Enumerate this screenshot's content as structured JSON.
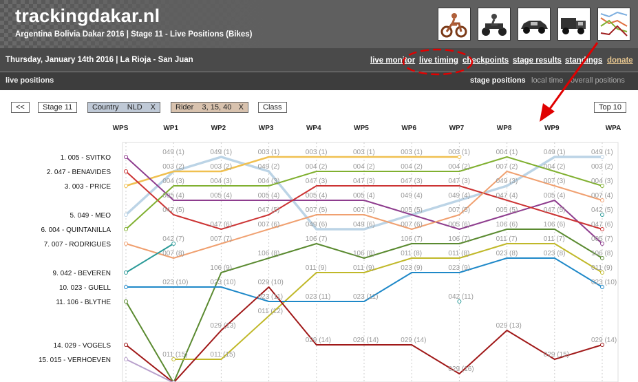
{
  "site": {
    "title": "trackingdakar.nl",
    "subtitle": "Argentina Bolivia Dakar 2016 | Stage 11 - Live Positions (Bikes)",
    "categories": [
      {
        "name": "bike-icon"
      },
      {
        "name": "quad-icon"
      },
      {
        "name": "car-icon"
      },
      {
        "name": "truck-icon"
      },
      {
        "name": "chart-icon"
      }
    ]
  },
  "subbar": {
    "date": "Thursday, January 14th 2016 | La Rioja - San Juan",
    "nav": [
      "live monitor",
      "live timing",
      "checkpoints",
      "stage results",
      "standings",
      "donate"
    ]
  },
  "viewbar": {
    "left": "live positions",
    "right": [
      "stage positions",
      "local time",
      "overall positions"
    ]
  },
  "filters": {
    "prev": "<<",
    "stage": "Stage 11",
    "country": "Country    NLD",
    "rider": "Rider    3, 15, 40",
    "class": "Class",
    "top": "Top 10",
    "remove": "X"
  },
  "colors": {
    "header_bg": "#5f5f5f",
    "subbar_bg": "#4a4a4a",
    "donate": "#e8c790",
    "country_chip": "#bfc9d6",
    "rider_chip": "#d8c2ae",
    "annotation_red": "#e00000"
  },
  "chart_data": {
    "type": "line",
    "waypoints": [
      "WPS",
      "WP1",
      "WP2",
      "WP3",
      "WP4",
      "WP5",
      "WP6",
      "WP7",
      "WP8",
      "WP9",
      "WPA"
    ],
    "rows": [
      "1. 005 - SVITKO",
      "2. 047 - BENAVIDES",
      "3. 003 - PRICE",
      "",
      "5. 049 - MEO",
      "6. 004 - QUINTANILLA",
      "7. 007 - RODRIGUES",
      "",
      "9. 042 - BEVEREN",
      "10. 023 - GUELL",
      "11. 106 - BLYTHE",
      "",
      "",
      "14. 029 - VOGELS",
      "15. 015 - VERHOEVEN"
    ],
    "series": [
      {
        "name": "049",
        "color": "#bcd4e6",
        "width": 3.5,
        "positions": [
          5,
          2,
          1,
          2,
          6,
          6,
          5,
          4,
          3,
          1,
          1
        ]
      },
      {
        "name": "003",
        "color": "#f0c050",
        "width": 2.5,
        "positions": [
          3,
          2,
          2,
          1,
          1,
          1,
          1,
          1,
          null,
          null,
          null
        ]
      },
      {
        "name": "005",
        "color": "#8e3d8e",
        "width": 2,
        "positions": [
          1,
          4,
          4,
          4,
          4,
          4,
          5,
          6,
          5,
          4,
          7
        ]
      },
      {
        "name": "047",
        "color": "#cc3333",
        "width": 2,
        "positions": [
          2,
          5,
          6,
          5,
          3,
          3,
          3,
          3,
          4,
          5,
          6
        ]
      },
      {
        "name": "004",
        "color": "#80b030",
        "width": 2,
        "positions": [
          6,
          3,
          3,
          3,
          2,
          2,
          2,
          2,
          1,
          2,
          3
        ]
      },
      {
        "name": "007",
        "color": "#f0a070",
        "width": 2,
        "positions": [
          7,
          8,
          7,
          6,
          5,
          5,
          6,
          5,
          2,
          3,
          4
        ]
      },
      {
        "name": "042",
        "color": "#2a9a98",
        "width": 2,
        "positions": [
          9,
          7,
          null,
          null,
          null,
          null,
          null,
          11,
          null,
          null,
          5
        ]
      },
      {
        "name": "106",
        "color": "#5a8a30",
        "width": 2,
        "positions": [
          11,
          19,
          9,
          8,
          7,
          8,
          7,
          7,
          6,
          6,
          8
        ]
      },
      {
        "name": "011",
        "color": "#c0b828",
        "width": 2,
        "positions": [
          null,
          15,
          15,
          12,
          9,
          9,
          8,
          8,
          7,
          7,
          9
        ]
      },
      {
        "name": "023",
        "color": "#1e88c8",
        "width": 2,
        "positions": [
          10,
          10,
          10,
          11,
          11,
          11,
          9,
          9,
          8,
          8,
          10
        ]
      },
      {
        "name": "029",
        "color": "#a01818",
        "width": 2,
        "positions": [
          14,
          19,
          13,
          10,
          14,
          14,
          14,
          16,
          13,
          15,
          14
        ]
      },
      {
        "name": "015",
        "color": "#b8a0cc",
        "width": 2,
        "positions": [
          15,
          19,
          null,
          null,
          null,
          null,
          null,
          null,
          null,
          null,
          null
        ]
      }
    ],
    "labels": [
      {
        "text": "049 (1)",
        "wp": 1,
        "pos": 1
      },
      {
        "text": "003 (2)",
        "wp": 1,
        "pos": 2
      },
      {
        "text": "004 (3)",
        "wp": 1,
        "pos": 3
      },
      {
        "text": "005 (4)",
        "wp": 1,
        "pos": 4
      },
      {
        "text": "047 (5)",
        "wp": 1,
        "pos": 5
      },
      {
        "text": "042 (7)",
        "wp": 1,
        "pos": 7
      },
      {
        "text": "007 (8)",
        "wp": 1,
        "pos": 8
      },
      {
        "text": "023 (10)",
        "wp": 1,
        "pos": 10
      },
      {
        "text": "011 (15)",
        "wp": 1,
        "pos": 15
      },
      {
        "text": "049 (1)",
        "wp": 2,
        "pos": 1
      },
      {
        "text": "003 (2)",
        "wp": 2,
        "pos": 2
      },
      {
        "text": "004 (3)",
        "wp": 2,
        "pos": 3
      },
      {
        "text": "005 (4)",
        "wp": 2,
        "pos": 4
      },
      {
        "text": "047 (6)",
        "wp": 2,
        "pos": 6
      },
      {
        "text": "007 (7)",
        "wp": 2,
        "pos": 7
      },
      {
        "text": "106 (9)",
        "wp": 2,
        "pos": 9
      },
      {
        "text": "023 (10)",
        "wp": 2,
        "pos": 10
      },
      {
        "text": "029 (13)",
        "wp": 2,
        "pos": 13
      },
      {
        "text": "011 (15)",
        "wp": 2,
        "pos": 15
      },
      {
        "text": "003 (1)",
        "wp": 3,
        "pos": 1
      },
      {
        "text": "049 (2)",
        "wp": 3,
        "pos": 2
      },
      {
        "text": "004 (3)",
        "wp": 3,
        "pos": 3
      },
      {
        "text": "005 (4)",
        "wp": 3,
        "pos": 4
      },
      {
        "text": "047 (5)",
        "wp": 3,
        "pos": 5
      },
      {
        "text": "007 (6)",
        "wp": 3,
        "pos": 6
      },
      {
        "text": "106 (8)",
        "wp": 3,
        "pos": 8
      },
      {
        "text": "029 (10)",
        "wp": 3,
        "pos": 10
      },
      {
        "text": "023 (11)",
        "wp": 3,
        "pos": 11
      },
      {
        "text": "011 (12)",
        "wp": 3,
        "pos": 12
      },
      {
        "text": "003 (1)",
        "wp": 4,
        "pos": 1
      },
      {
        "text": "004 (2)",
        "wp": 4,
        "pos": 2
      },
      {
        "text": "047 (3)",
        "wp": 4,
        "pos": 3
      },
      {
        "text": "005 (4)",
        "wp": 4,
        "pos": 4
      },
      {
        "text": "007 (5)",
        "wp": 4,
        "pos": 5
      },
      {
        "text": "049 (6)",
        "wp": 4,
        "pos": 6
      },
      {
        "text": "106 (7)",
        "wp": 4,
        "pos": 7
      },
      {
        "text": "011 (9)",
        "wp": 4,
        "pos": 9
      },
      {
        "text": "023 (11)",
        "wp": 4,
        "pos": 11
      },
      {
        "text": "029 (14)",
        "wp": 4,
        "pos": 14
      },
      {
        "text": "003 (1)",
        "wp": 5,
        "pos": 1
      },
      {
        "text": "004 (2)",
        "wp": 5,
        "pos": 2
      },
      {
        "text": "047 (3)",
        "wp": 5,
        "pos": 3
      },
      {
        "text": "005 (4)",
        "wp": 5,
        "pos": 4
      },
      {
        "text": "007 (5)",
        "wp": 5,
        "pos": 5
      },
      {
        "text": "049 (6)",
        "wp": 5,
        "pos": 6
      },
      {
        "text": "106 (8)",
        "wp": 5,
        "pos": 8
      },
      {
        "text": "011 (9)",
        "wp": 5,
        "pos": 9
      },
      {
        "text": "023 (11)",
        "wp": 5,
        "pos": 11
      },
      {
        "text": "029 (14)",
        "wp": 5,
        "pos": 14
      },
      {
        "text": "003 (1)",
        "wp": 6,
        "pos": 1
      },
      {
        "text": "004 (2)",
        "wp": 6,
        "pos": 2
      },
      {
        "text": "047 (3)",
        "wp": 6,
        "pos": 3
      },
      {
        "text": "049 (4)",
        "wp": 6,
        "pos": 4
      },
      {
        "text": "005 (5)",
        "wp": 6,
        "pos": 5
      },
      {
        "text": "007 (6)",
        "wp": 6,
        "pos": 6
      },
      {
        "text": "106 (7)",
        "wp": 6,
        "pos": 7
      },
      {
        "text": "011 (8)",
        "wp": 6,
        "pos": 8
      },
      {
        "text": "023 (9)",
        "wp": 6,
        "pos": 9
      },
      {
        "text": "029 (14)",
        "wp": 6,
        "pos": 14
      },
      {
        "text": "003 (1)",
        "wp": 7,
        "pos": 1
      },
      {
        "text": "004 (2)",
        "wp": 7,
        "pos": 2
      },
      {
        "text": "047 (3)",
        "wp": 7,
        "pos": 3
      },
      {
        "text": "049 (4)",
        "wp": 7,
        "pos": 4
      },
      {
        "text": "007 (5)",
        "wp": 7,
        "pos": 5
      },
      {
        "text": "005 (6)",
        "wp": 7,
        "pos": 6
      },
      {
        "text": "106 (7)",
        "wp": 7,
        "pos": 7
      },
      {
        "text": "011 (8)",
        "wp": 7,
        "pos": 8
      },
      {
        "text": "023 (9)",
        "wp": 7,
        "pos": 9
      },
      {
        "text": "042 (11)",
        "wp": 7,
        "pos": 11
      },
      {
        "text": "029 (16)",
        "wp": 7,
        "pos": 16
      },
      {
        "text": "004 (1)",
        "wp": 8,
        "pos": 1
      },
      {
        "text": "007 (2)",
        "wp": 8,
        "pos": 2
      },
      {
        "text": "049 (3)",
        "wp": 8,
        "pos": 3
      },
      {
        "text": "047 (4)",
        "wp": 8,
        "pos": 4
      },
      {
        "text": "005 (5)",
        "wp": 8,
        "pos": 5
      },
      {
        "text": "106 (6)",
        "wp": 8,
        "pos": 6
      },
      {
        "text": "011 (7)",
        "wp": 8,
        "pos": 7
      },
      {
        "text": "023 (8)",
        "wp": 8,
        "pos": 8
      },
      {
        "text": "029 (13)",
        "wp": 8,
        "pos": 13
      },
      {
        "text": "049 (1)",
        "wp": 9,
        "pos": 1
      },
      {
        "text": "004 (2)",
        "wp": 9,
        "pos": 2
      },
      {
        "text": "007 (3)",
        "wp": 9,
        "pos": 3
      },
      {
        "text": "005 (4)",
        "wp": 9,
        "pos": 4
      },
      {
        "text": "047 (5)",
        "wp": 9,
        "pos": 5
      },
      {
        "text": "106 (6)",
        "wp": 9,
        "pos": 6
      },
      {
        "text": "011 (7)",
        "wp": 9,
        "pos": 7
      },
      {
        "text": "023 (8)",
        "wp": 9,
        "pos": 8
      },
      {
        "text": "029 (15)",
        "wp": 9,
        "pos": 15
      },
      {
        "text": "049 (1)",
        "wp": 10,
        "pos": 1
      },
      {
        "text": "003 (2)",
        "wp": 10,
        "pos": 2
      },
      {
        "text": "004 (3)",
        "wp": 10,
        "pos": 3
      },
      {
        "text": "007 (4)",
        "wp": 10,
        "pos": 4
      },
      {
        "text": "042 (5)",
        "wp": 10,
        "pos": 5
      },
      {
        "text": "047 (6)",
        "wp": 10,
        "pos": 6
      },
      {
        "text": "005 (7)",
        "wp": 10,
        "pos": 7
      },
      {
        "text": "106 (8)",
        "wp": 10,
        "pos": 8
      },
      {
        "text": "011 (9)",
        "wp": 10,
        "pos": 9
      },
      {
        "text": "023 (10)",
        "wp": 10,
        "pos": 10
      },
      {
        "text": "029 (14)",
        "wp": 10,
        "pos": 14
      }
    ]
  }
}
